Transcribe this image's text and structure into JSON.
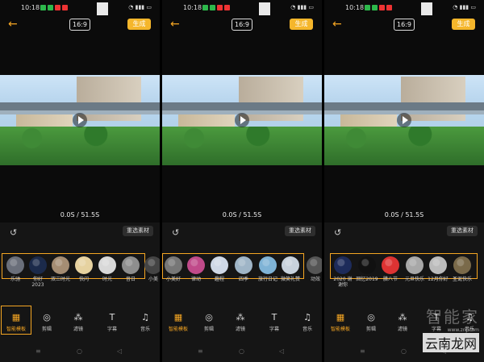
{
  "status": {
    "time": "10:18"
  },
  "topbar": {
    "back": "←",
    "ratio": "16:9",
    "generate": "生成"
  },
  "player": {
    "timecode": "0.0S / 51.5S"
  },
  "editor": {
    "undo": "↺",
    "reselect": "重选素材"
  },
  "panels": [
    {
      "templates": [
        {
          "label": "乐驰"
        },
        {
          "label": "你好\n2023"
        },
        {
          "label": "双三时光"
        },
        {
          "label": "快闪"
        },
        {
          "label": "时光"
        },
        {
          "label": "音日"
        },
        {
          "label": "小美"
        }
      ]
    },
    {
      "templates": [
        {
          "label": "小美好"
        },
        {
          "label": "律动"
        },
        {
          "label": "趣程"
        },
        {
          "label": "四季"
        },
        {
          "label": "旅行日记"
        },
        {
          "label": "微笑礼赞"
        },
        {
          "label": "动效"
        }
      ]
    },
    {
      "templates": [
        {
          "label": "2020 谢\n谢你"
        },
        {
          "label": "回忆2019"
        },
        {
          "label": "腊八节"
        },
        {
          "label": "元旦快乐"
        },
        {
          "label": "12月你好"
        },
        {
          "label": "圣诞快乐"
        }
      ]
    }
  ],
  "tabs": [
    {
      "label": "智能模板",
      "icon": "grid-icon"
    },
    {
      "label": "剪辑",
      "icon": "scissors-icon"
    },
    {
      "label": "滤镜",
      "icon": "filter-icon"
    },
    {
      "label": "字幕",
      "icon": "text-icon"
    },
    {
      "label": "音乐",
      "icon": "music-icon"
    }
  ],
  "watermark": {
    "brand": "智能家",
    "site": "www.znj.com",
    "logo": "云南龙网"
  },
  "colors": {
    "accent": "#f5a623",
    "generate_bg": "#f5b62b"
  }
}
